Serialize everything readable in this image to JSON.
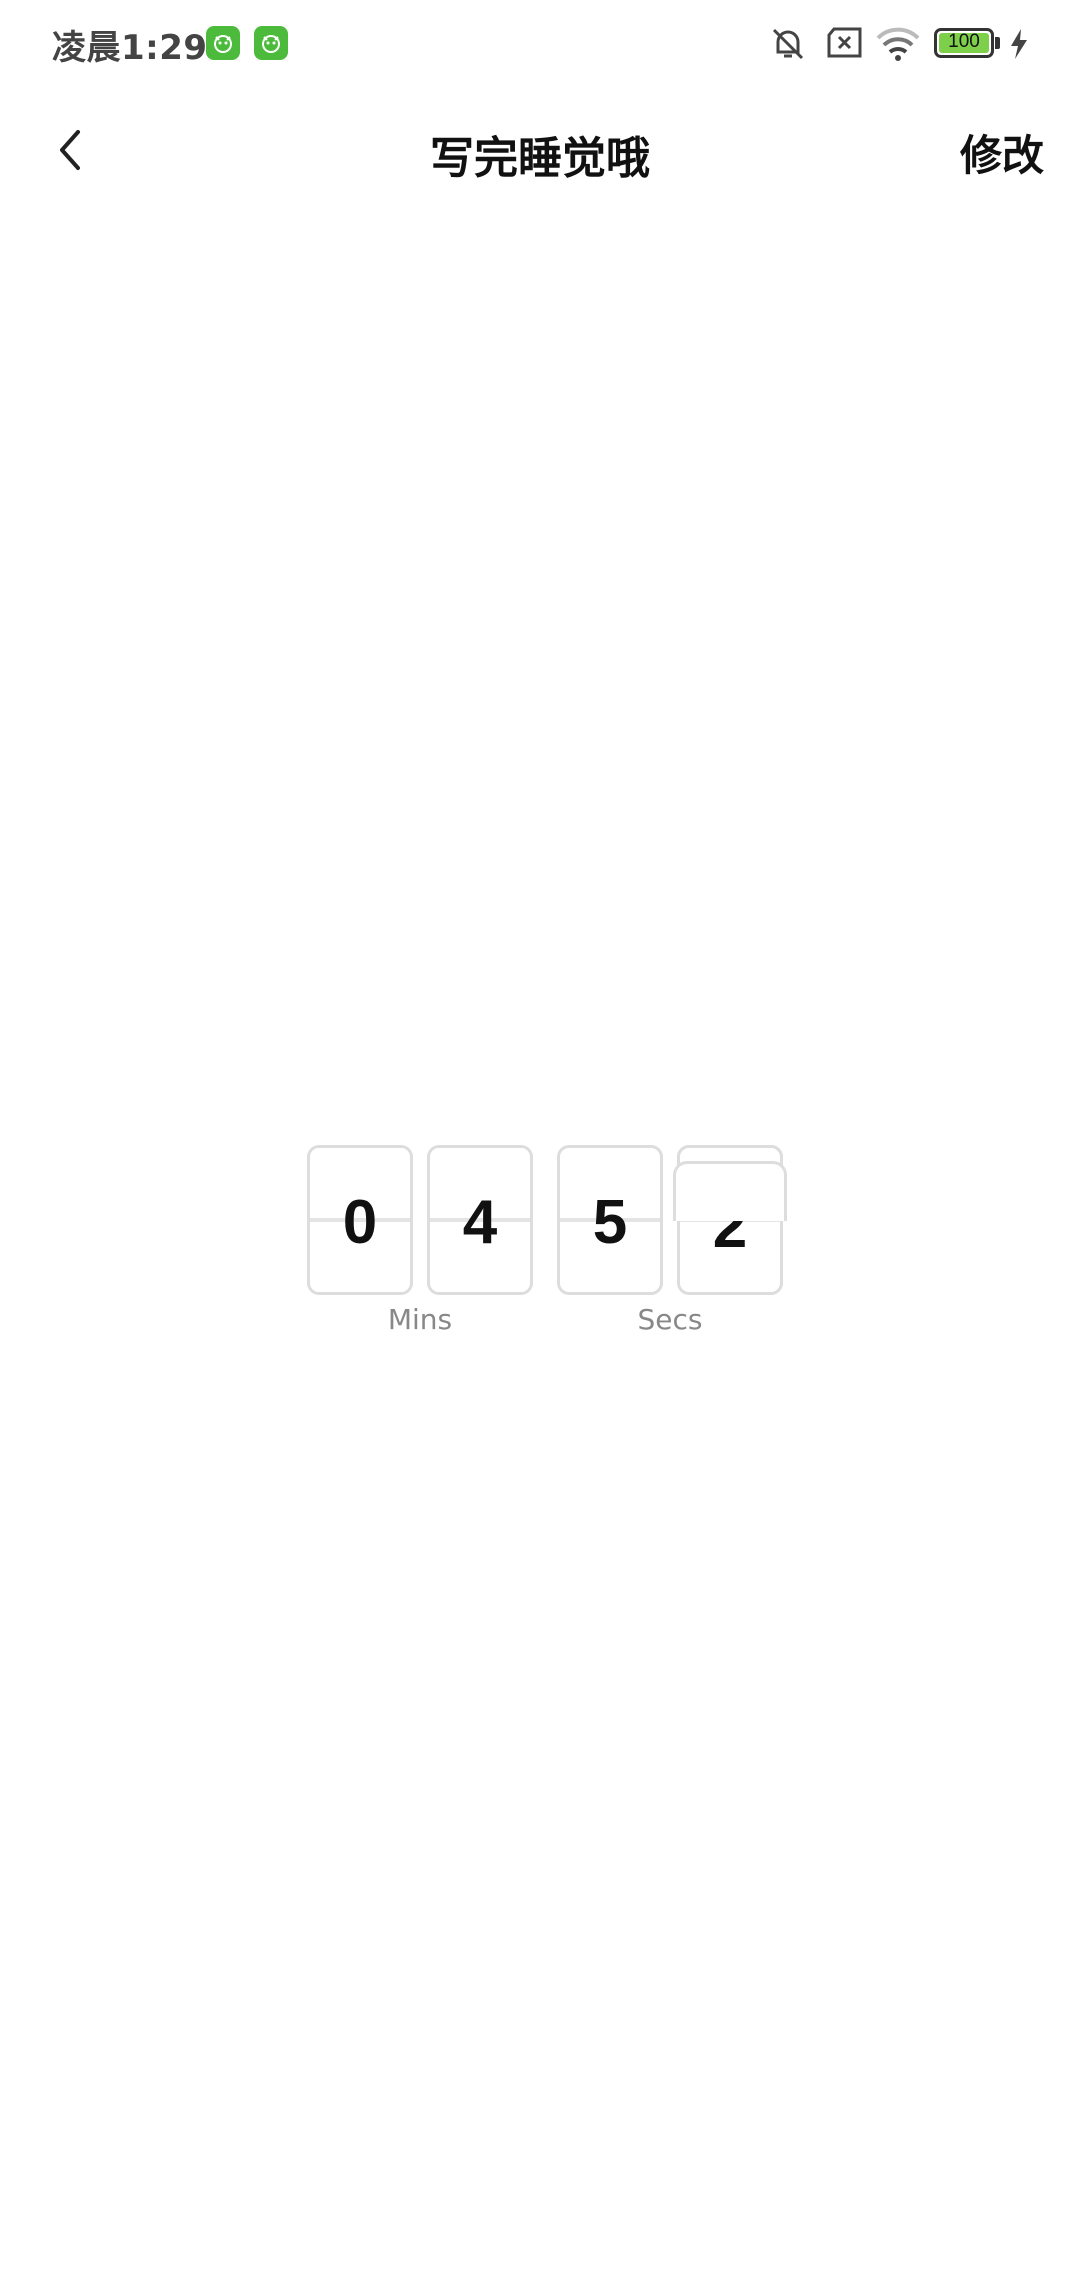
{
  "status_bar": {
    "time": "凌晨1:29",
    "battery": "100",
    "icons": [
      "app-notification-icon",
      "app-notification-icon",
      "silent-mode-icon",
      "sim-error-icon",
      "wifi-icon",
      "battery-icon",
      "charging-icon"
    ]
  },
  "nav": {
    "title": "写完睡觉哦",
    "edit_label": "修改",
    "back_icon": "chevron-left-icon"
  },
  "countdown": {
    "minutes_digits": [
      "0",
      "4"
    ],
    "seconds_digits": [
      "5",
      "2"
    ],
    "minutes_label": "Mins",
    "seconds_label": "Secs"
  },
  "colors": {
    "app_badge": "#4cbb3c",
    "battery_fill": "#7ed04b",
    "card_border": "#dddddd",
    "label_gray": "#888888"
  }
}
